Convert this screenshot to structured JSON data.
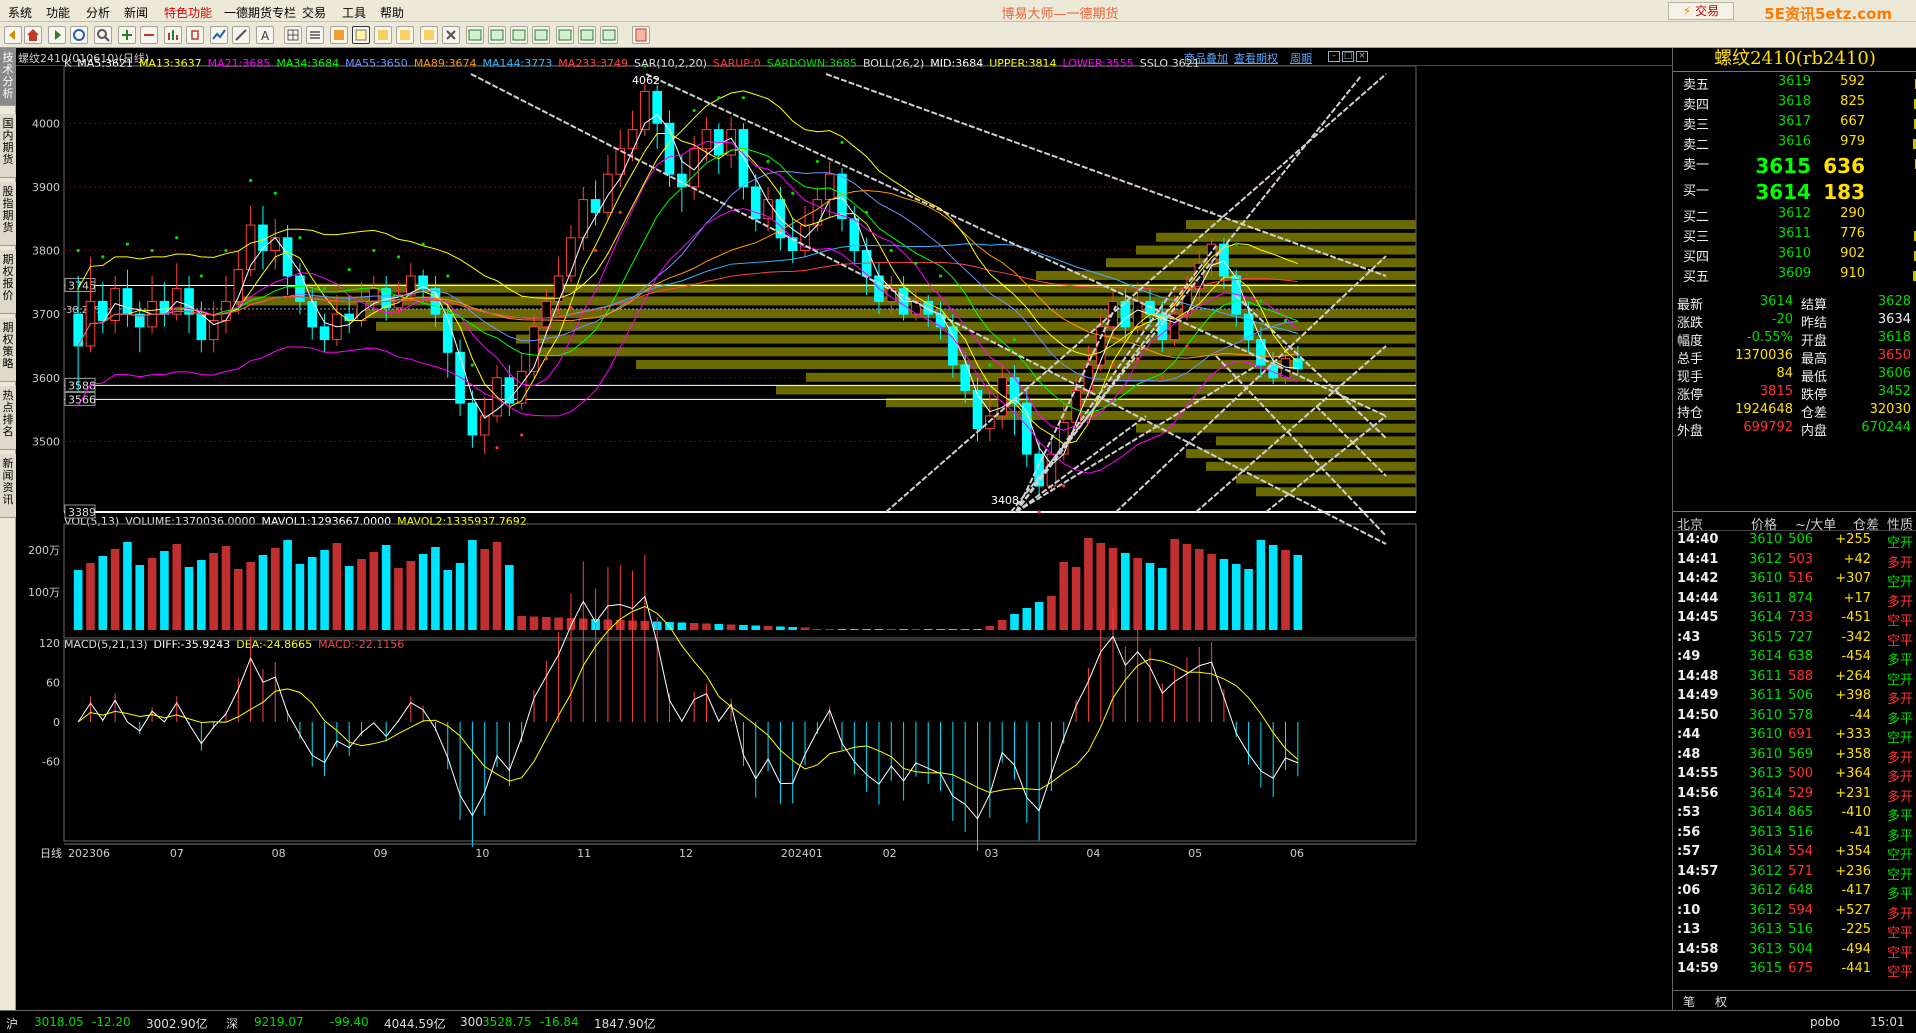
{
  "menu": [
    "系统",
    "功能",
    "分析",
    "新闻",
    "特色功能",
    "一德期货专栏",
    "交易",
    "工具",
    "帮助"
  ],
  "title": "博易大师—一德期货",
  "trade_button": "交易",
  "brand": "5E资讯5etz.com",
  "left_tabs": [
    "技术分析",
    "国内期货",
    "股指期货",
    "期权报价",
    "期权策略",
    "热点排名",
    "新闻资讯"
  ],
  "chart_header": {
    "symbol": "螺纹2410(010610)(日线)",
    "links": [
      "商品叠加",
      "查看期权",
      "周期"
    ]
  },
  "ma_line": [
    {
      "t": "K",
      "c": "#dddddd"
    },
    {
      "t": "MA5:3621",
      "c": "#ffffff"
    },
    {
      "t": "MA13:3637",
      "c": "#ffff00"
    },
    {
      "t": "MA21:3685",
      "c": "#ff00ff"
    },
    {
      "t": "MA34:3684",
      "c": "#00ff00"
    },
    {
      "t": "MA55:3650",
      "c": "#6f90ff"
    },
    {
      "t": "MA89:3674",
      "c": "#ff9900"
    },
    {
      "t": "MA144:3773",
      "c": "#33b3ff"
    },
    {
      "t": "MA233:3749",
      "c": "#ff4444"
    },
    {
      "t": "SAR(10,2,20)",
      "c": "#dddddd"
    },
    {
      "t": "SARUP:0",
      "c": "#ff3333"
    },
    {
      "t": "SARDOWN:3685",
      "c": "#00dd00"
    },
    {
      "t": "BOLL(26,2)",
      "c": "#dddddd"
    },
    {
      "t": "MID:3684",
      "c": "#ffffff"
    },
    {
      "t": "UPPER:3814",
      "c": "#ffff00"
    },
    {
      "t": "LOWER:3555",
      "c": "#ff00ff"
    },
    {
      "t": "SSLO 3621",
      "c": "#dddddd"
    }
  ],
  "main_axis": {
    "ticks": [
      "4000",
      "3900",
      "3800",
      "3700",
      "3600",
      "3500"
    ],
    "boxes": [
      "3745",
      "3588",
      "3566",
      "3389"
    ],
    "fib": "38.20%"
  },
  "annotations": {
    "high": "4062",
    "low": "3408"
  },
  "vol_caption": [
    {
      "t": "VOL(5,13)",
      "c": "#dddddd"
    },
    {
      "t": "VOLUME:1370036.0000",
      "c": "#dddddd"
    },
    {
      "t": "MAVOL1:1293667.0000",
      "c": "#ffffff"
    },
    {
      "t": "MAVOL2:1335937.7692",
      "c": "#ffff00"
    }
  ],
  "vol_axis": [
    "200万",
    "100万"
  ],
  "macd_caption": [
    {
      "t": "MACD(5,21,13)",
      "c": "#dddddd"
    },
    {
      "t": "DIFF:-35.9243",
      "c": "#ffffff"
    },
    {
      "t": "DEA:-24.8665",
      "c": "#ffff00"
    },
    {
      "t": "MACD:-22.1156",
      "c": "#ff4444"
    }
  ],
  "macd_axis": [
    "120",
    "60",
    "0",
    "-60"
  ],
  "x_axis": {
    "label": "日线",
    "ticks": [
      "202306",
      "07",
      "08",
      "09",
      "10",
      "11",
      "12",
      "202401",
      "02",
      "03",
      "04",
      "05",
      "06"
    ]
  },
  "contract": "螺纹2410(rb2410)",
  "orderbook": [
    {
      "label": "卖五",
      "price": "3619",
      "vol": "592",
      "bar": 0.22
    },
    {
      "label": "卖四",
      "price": "3618",
      "vol": "825",
      "bar": 0.3
    },
    {
      "label": "卖三",
      "price": "3617",
      "vol": "667",
      "bar": 0.25
    },
    {
      "label": "卖二",
      "price": "3616",
      "vol": "979",
      "bar": 0.38
    },
    {
      "label": "卖一",
      "price": "3615",
      "vol": "636",
      "bar": 0.24
    },
    {
      "label": "买一",
      "price": "3614",
      "vol": "183",
      "bar": 0.07
    },
    {
      "label": "买二",
      "price": "3612",
      "vol": "290",
      "bar": 0.11
    },
    {
      "label": "买三",
      "price": "3611",
      "vol": "776",
      "bar": 0.29
    },
    {
      "label": "买四",
      "price": "3610",
      "vol": "902",
      "bar": 0.34
    },
    {
      "label": "买五",
      "price": "3609",
      "vol": "910",
      "bar": 0.35
    }
  ],
  "stats": [
    {
      "l1": "最新",
      "v1": "3614",
      "c1": "#00dd00",
      "l2": "结算",
      "v2": "3628",
      "c2": "#00dd00"
    },
    {
      "l1": "涨跌",
      "v1": "-20",
      "c1": "#00dd00",
      "l2": "昨结",
      "v2": "3634",
      "c2": "#eeeeee"
    },
    {
      "l1": "幅度",
      "v1": "-0.55%",
      "c1": "#00dd00",
      "l2": "开盘",
      "v2": "3618",
      "c2": "#00dd00"
    },
    {
      "l1": "总手",
      "v1": "1370036",
      "c1": "#ffe000",
      "l2": "最高",
      "v2": "3650",
      "c2": "#ff3333"
    },
    {
      "l1": "现手",
      "v1": "84",
      "c1": "#ffe000",
      "l2": "最低",
      "v2": "3606",
      "c2": "#00dd00"
    },
    {
      "l1": "涨停",
      "v1": "3815",
      "c1": "#ff3333",
      "l2": "跌停",
      "v2": "3452",
      "c2": "#00dd00"
    },
    {
      "l1": "持仓",
      "v1": "1924648",
      "c1": "#ffe000",
      "l2": "仓差",
      "v2": "32030",
      "c2": "#ffe000"
    },
    {
      "l1": "外盘",
      "v1": "699792",
      "c1": "#ff3333",
      "l2": "内盘",
      "v2": "670244",
      "c2": "#00dd00"
    }
  ],
  "ticks_header": {
    "loc": "北京",
    "price": "价格",
    "vol": "~/大单",
    "diff": "仓差",
    "nature": "性质"
  },
  "ticks": [
    {
      "time": "14:40",
      "price": "3610",
      "vol": "506",
      "diff": "+255",
      "nature": "空开"
    },
    {
      "time": "14:41",
      "price": "3612",
      "vol": "503",
      "diff": "+42",
      "nature": "多开"
    },
    {
      "time": "14:42",
      "price": "3610",
      "vol": "516",
      "diff": "+307",
      "nature": "空开"
    },
    {
      "time": "14:44",
      "price": "3611",
      "vol": "874",
      "diff": "+17",
      "nature": "多开"
    },
    {
      "time": "14:45",
      "price": "3614",
      "vol": "733",
      "diff": "-451",
      "nature": "空平"
    },
    {
      "time": ":43",
      "price": "3615",
      "vol": "727",
      "diff": "-342",
      "nature": "空平"
    },
    {
      "time": ":49",
      "price": "3614",
      "vol": "638",
      "diff": "-454",
      "nature": "多平"
    },
    {
      "time": "14:48",
      "price": "3611",
      "vol": "588",
      "diff": "+264",
      "nature": "空开"
    },
    {
      "time": "14:49",
      "price": "3611",
      "vol": "506",
      "diff": "+398",
      "nature": "多开"
    },
    {
      "time": "14:50",
      "price": "3610",
      "vol": "578",
      "diff": "-44",
      "nature": "多平"
    },
    {
      "time": ":44",
      "price": "3610",
      "vol": "691",
      "diff": "+333",
      "nature": "空开"
    },
    {
      "time": ":48",
      "price": "3610",
      "vol": "569",
      "diff": "+358",
      "nature": "多开"
    },
    {
      "time": "14:55",
      "price": "3613",
      "vol": "500",
      "diff": "+364",
      "nature": "多开"
    },
    {
      "time": "14:56",
      "price": "3614",
      "vol": "529",
      "diff": "+231",
      "nature": "多开"
    },
    {
      "time": ":53",
      "price": "3614",
      "vol": "865",
      "diff": "-410",
      "nature": "多平"
    },
    {
      "time": ":56",
      "price": "3613",
      "vol": "516",
      "diff": "-41",
      "nature": "多平"
    },
    {
      "time": ":57",
      "price": "3614",
      "vol": "554",
      "diff": "+354",
      "nature": "空开"
    },
    {
      "time": "14:57",
      "price": "3612",
      "vol": "571",
      "diff": "+236",
      "nature": "空开"
    },
    {
      "time": ":06",
      "price": "3612",
      "vol": "648",
      "diff": "-417",
      "nature": "多平"
    },
    {
      "time": ":10",
      "price": "3612",
      "vol": "594",
      "diff": "+527",
      "nature": "多开"
    },
    {
      "time": ":13",
      "price": "3613",
      "vol": "516",
      "diff": "-225",
      "nature": "空平"
    },
    {
      "time": "14:58",
      "price": "3613",
      "vol": "504",
      "diff": "-494",
      "nature": "空平"
    },
    {
      "time": "14:59",
      "price": "3615",
      "vol": "675",
      "diff": "-441",
      "nature": "空平"
    }
  ],
  "right_tabs": [
    "笔",
    "权"
  ],
  "statusbar": [
    {
      "t": "沪",
      "c": "#dddddd"
    },
    {
      "t": "3018.05",
      "c": "#00dd00"
    },
    {
      "t": "-12.20",
      "c": "#00dd00"
    },
    {
      "t": "3002.90亿",
      "c": "#dddddd"
    },
    {
      "t": "深",
      "c": "#dddddd"
    },
    {
      "t": "9219.07",
      "c": "#00dd00"
    },
    {
      "t": "-99.40",
      "c": "#00dd00"
    },
    {
      "t": "4044.59亿",
      "c": "#dddddd"
    },
    {
      "t": "300",
      "c": "#dddddd"
    },
    {
      "t": "3528.75",
      "c": "#00dd00"
    },
    {
      "t": "-16.84",
      "c": "#00dd00"
    },
    {
      "t": "1847.90亿",
      "c": "#dddddd"
    },
    {
      "t": "pobo",
      "c": "#dddddd"
    },
    {
      "t": "15:01",
      "c": "#dddddd"
    }
  ],
  "chart_data": {
    "type": "candlestick",
    "y_range": [
      3389,
      4090
    ],
    "candles": [
      [
        3700,
        3650,
        3580,
        3760
      ],
      [
        3650,
        3720,
        3640,
        3790
      ],
      [
        3720,
        3690,
        3670,
        3750
      ],
      [
        3690,
        3740,
        3670,
        3760
      ],
      [
        3740,
        3700,
        3680,
        3770
      ],
      [
        3700,
        3680,
        3640,
        3720
      ],
      [
        3680,
        3720,
        3670,
        3760
      ],
      [
        3720,
        3700,
        3680,
        3750
      ],
      [
        3700,
        3740,
        3690,
        3780
      ],
      [
        3740,
        3700,
        3670,
        3760
      ],
      [
        3700,
        3660,
        3640,
        3720
      ],
      [
        3660,
        3690,
        3640,
        3720
      ],
      [
        3690,
        3720,
        3670,
        3760
      ],
      [
        3720,
        3770,
        3700,
        3800
      ],
      [
        3770,
        3840,
        3760,
        3870
      ],
      [
        3840,
        3800,
        3770,
        3870
      ],
      [
        3800,
        3820,
        3770,
        3850
      ],
      [
        3820,
        3760,
        3730,
        3840
      ],
      [
        3760,
        3720,
        3700,
        3780
      ],
      [
        3720,
        3680,
        3660,
        3740
      ],
      [
        3680,
        3660,
        3640,
        3700
      ],
      [
        3660,
        3700,
        3650,
        3730
      ],
      [
        3700,
        3690,
        3670,
        3730
      ],
      [
        3690,
        3720,
        3680,
        3750
      ],
      [
        3720,
        3740,
        3700,
        3760
      ],
      [
        3740,
        3710,
        3690,
        3760
      ],
      [
        3710,
        3730,
        3700,
        3750
      ],
      [
        3730,
        3760,
        3720,
        3780
      ],
      [
        3760,
        3740,
        3720,
        3770
      ],
      [
        3740,
        3700,
        3680,
        3760
      ],
      [
        3700,
        3640,
        3600,
        3720
      ],
      [
        3640,
        3560,
        3540,
        3660
      ],
      [
        3560,
        3510,
        3490,
        3580
      ],
      [
        3510,
        3540,
        3480,
        3570
      ],
      [
        3540,
        3600,
        3530,
        3620
      ],
      [
        3600,
        3560,
        3540,
        3620
      ],
      [
        3560,
        3610,
        3550,
        3640
      ],
      [
        3610,
        3680,
        3600,
        3700
      ],
      [
        3680,
        3720,
        3670,
        3740
      ],
      [
        3720,
        3760,
        3700,
        3790
      ],
      [
        3760,
        3820,
        3750,
        3840
      ],
      [
        3820,
        3880,
        3800,
        3900
      ],
      [
        3880,
        3860,
        3840,
        3910
      ],
      [
        3860,
        3920,
        3850,
        3950
      ],
      [
        3920,
        3960,
        3900,
        3990
      ],
      [
        3960,
        3990,
        3940,
        4020
      ],
      [
        3990,
        4050,
        3980,
        4062
      ],
      [
        4050,
        4000,
        3960,
        4060
      ],
      [
        4000,
        3920,
        3900,
        4020
      ],
      [
        3920,
        3900,
        3860,
        3950
      ],
      [
        3900,
        3960,
        3880,
        3980
      ],
      [
        3960,
        3990,
        3940,
        4010
      ],
      [
        3990,
        3950,
        3920,
        4000
      ],
      [
        3950,
        3990,
        3930,
        4010
      ],
      [
        3990,
        3900,
        3880,
        4000
      ],
      [
        3900,
        3850,
        3830,
        3920
      ],
      [
        3850,
        3880,
        3830,
        3900
      ],
      [
        3880,
        3820,
        3800,
        3900
      ],
      [
        3820,
        3800,
        3780,
        3850
      ],
      [
        3800,
        3840,
        3790,
        3870
      ],
      [
        3840,
        3880,
        3830,
        3900
      ],
      [
        3880,
        3920,
        3850,
        3940
      ],
      [
        3920,
        3850,
        3830,
        3930
      ],
      [
        3850,
        3800,
        3780,
        3870
      ],
      [
        3800,
        3760,
        3730,
        3820
      ],
      [
        3760,
        3720,
        3700,
        3780
      ],
      [
        3720,
        3740,
        3700,
        3760
      ],
      [
        3740,
        3700,
        3690,
        3760
      ],
      [
        3700,
        3720,
        3690,
        3740
      ],
      [
        3720,
        3700,
        3680,
        3730
      ],
      [
        3700,
        3680,
        3660,
        3720
      ],
      [
        3680,
        3620,
        3600,
        3700
      ],
      [
        3620,
        3580,
        3560,
        3640
      ],
      [
        3580,
        3520,
        3500,
        3600
      ],
      [
        3520,
        3540,
        3500,
        3580
      ],
      [
        3540,
        3600,
        3520,
        3620
      ],
      [
        3600,
        3560,
        3510,
        3620
      ],
      [
        3560,
        3480,
        3460,
        3580
      ],
      [
        3480,
        3430,
        3408,
        3500
      ],
      [
        3430,
        3480,
        3420,
        3510
      ],
      [
        3480,
        3530,
        3470,
        3560
      ],
      [
        3530,
        3580,
        3520,
        3600
      ],
      [
        3580,
        3620,
        3570,
        3650
      ],
      [
        3620,
        3680,
        3610,
        3700
      ],
      [
        3680,
        3720,
        3660,
        3740
      ],
      [
        3720,
        3680,
        3660,
        3740
      ],
      [
        3680,
        3720,
        3670,
        3750
      ],
      [
        3720,
        3700,
        3680,
        3740
      ],
      [
        3700,
        3660,
        3640,
        3720
      ],
      [
        3660,
        3700,
        3650,
        3730
      ],
      [
        3700,
        3740,
        3690,
        3760
      ],
      [
        3740,
        3780,
        3720,
        3800
      ],
      [
        3780,
        3810,
        3760,
        3820
      ],
      [
        3810,
        3760,
        3740,
        3820
      ],
      [
        3760,
        3700,
        3680,
        3770
      ],
      [
        3700,
        3660,
        3640,
        3720
      ],
      [
        3660,
        3620,
        3600,
        3680
      ],
      [
        3620,
        3600,
        3590,
        3640
      ],
      [
        3600,
        3630,
        3590,
        3650
      ],
      [
        3630,
        3614,
        3606,
        3650
      ]
    ],
    "volume_relative": "daily volume in 万 units (peak ≈ 230万)",
    "macd_range": [
      -100,
      140
    ]
  }
}
